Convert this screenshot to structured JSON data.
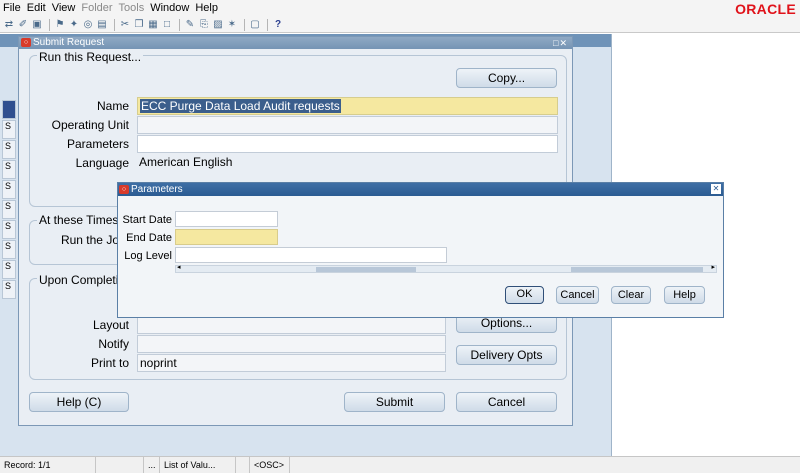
{
  "menubar": {
    "items": [
      "File",
      "Edit",
      "View",
      "Folder",
      "Tools",
      "Window",
      "Help"
    ],
    "logo": "ORACLE"
  },
  "toolbar": {
    "icons": [
      "save-icon",
      "print-icon",
      "switch-icon",
      "find-icon",
      "nav-icon",
      "zoom-icon",
      "new-icon",
      "clear-icon",
      "delete-icon",
      "cut-icon",
      "copy-icon",
      "paste-icon",
      "edit-icon",
      "attach-icon",
      "folder-icon",
      "translate-icon",
      "help-icon"
    ]
  },
  "submit_window": {
    "title": "Submit Request",
    "run_section_label": "Run this Request...",
    "copy_button": "Copy...",
    "name_label": "Name",
    "name_value": "ECC Purge Data Load Audit requests",
    "operating_unit_label": "Operating Unit",
    "operating_unit_value": "",
    "parameters_label": "Parameters",
    "parameters_value": "",
    "language_label": "Language",
    "language_value": "American English",
    "times_section_label": "At these Times.",
    "run_job_label": "Run the Jo",
    "completion_section_label": "Upon Completio",
    "layout_label": "Layout",
    "notify_label": "Notify",
    "print_to_label": "Print to",
    "print_to_value": "noprint",
    "options_button": "Options...",
    "delivery_button": "Delivery Opts",
    "help_button": "Help (C)",
    "submit_button": "Submit",
    "cancel_button": "Cancel"
  },
  "parameters_dialog": {
    "title": "Parameters",
    "start_date_label": "Start Date",
    "start_date_value": "",
    "end_date_label": "End Date",
    "end_date_value": "",
    "log_level_label": "Log Level",
    "log_level_value": "",
    "ok_button": "OK",
    "cancel_button": "Cancel",
    "clear_button": "Clear",
    "help_button": "Help"
  },
  "background": {
    "left_column": [
      "S",
      "S",
      "S",
      "S",
      "S",
      "S",
      "S",
      "S",
      "S",
      "S"
    ]
  },
  "statusbar": {
    "record": "Record: 1/1",
    "segment2": "",
    "segment3": "...",
    "list_of_values": "List of Valu...",
    "segment5": "",
    "osc": "<OSC>"
  },
  "colors": {
    "accent": "#2b5b92",
    "required_field": "#f5e8a0",
    "window_bg": "#e9eef4",
    "oracle_red": "#e0121a"
  }
}
